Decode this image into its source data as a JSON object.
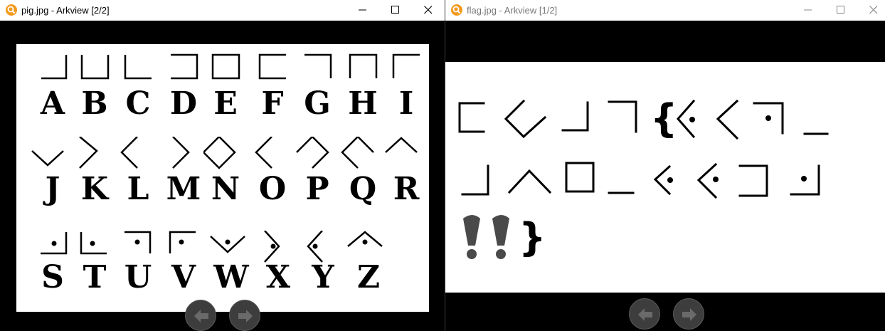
{
  "windows": [
    {
      "title": "pig.jpg - Arkview [2/2]",
      "legend_letters": [
        "A",
        "B",
        "C",
        "D",
        "E",
        "F",
        "G",
        "H",
        "I",
        "J",
        "K",
        "L",
        "M",
        "N",
        "O",
        "P",
        "Q",
        "R",
        "S",
        "T",
        "U",
        "V",
        "W",
        "X",
        "Y",
        "Z"
      ]
    },
    {
      "title": "flag.jpg - Arkview [1/2]",
      "flag_braces": {
        "open": "{",
        "close": "}"
      },
      "flag_marks": [
        "!",
        "!"
      ]
    }
  ],
  "titlebar_icons": [
    "minimize-icon",
    "maximize-icon",
    "close-icon"
  ],
  "nav_icons": [
    "arrow-left-icon",
    "arrow-right-icon"
  ],
  "colors": {
    "accent": "#f39a1e",
    "titlebar": "#ffffff",
    "viewer_bg": "#000000"
  }
}
